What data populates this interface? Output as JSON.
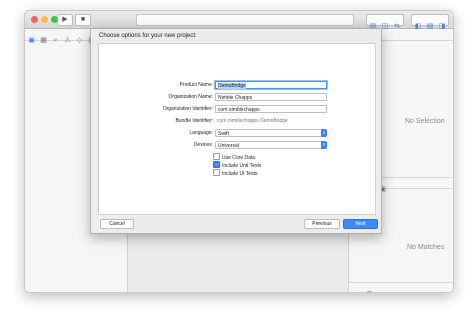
{
  "toolbar": {
    "run_icon": "▶",
    "stop_icon": "■",
    "traffic_light_colors": [
      "#fc605c",
      "#fdbc40",
      "#34c84a"
    ]
  },
  "navigator": {
    "icons": [
      "▣",
      "▦",
      "⌕",
      "⚠",
      "◇",
      "▤"
    ]
  },
  "inspector": {
    "top_icons": [
      "□",
      "?"
    ],
    "no_selection": "No Selection",
    "library_icons": [
      "{}",
      "○",
      "▣"
    ],
    "no_matches": "No Matches",
    "filter_icons": [
      "⊞",
      "☰"
    ]
  },
  "sheet": {
    "title": "Choose options for your new project:",
    "fields": {
      "product_name": {
        "label": "Product Name:",
        "value": "DemoBridge"
      },
      "organization_name": {
        "label": "Organization Name:",
        "value": "Nimble Chapps"
      },
      "organization_identifier": {
        "label": "Organization Identifier:",
        "value": "com.nimblechapps"
      },
      "bundle_identifier": {
        "label": "Bundle Identifier:",
        "value": "com.nimblechapps.DemoBridge"
      },
      "language": {
        "label": "Language:",
        "value": "Swift"
      },
      "devices": {
        "label": "Devices:",
        "value": "Universal"
      }
    },
    "checkboxes": [
      {
        "label": "Use Core Data",
        "checked": false
      },
      {
        "label": "Include Unit Tests",
        "checked": true
      },
      {
        "label": "Include UI Tests",
        "checked": false
      }
    ],
    "buttons": {
      "cancel": "Cancel",
      "previous": "Previous",
      "next": "Next"
    }
  }
}
